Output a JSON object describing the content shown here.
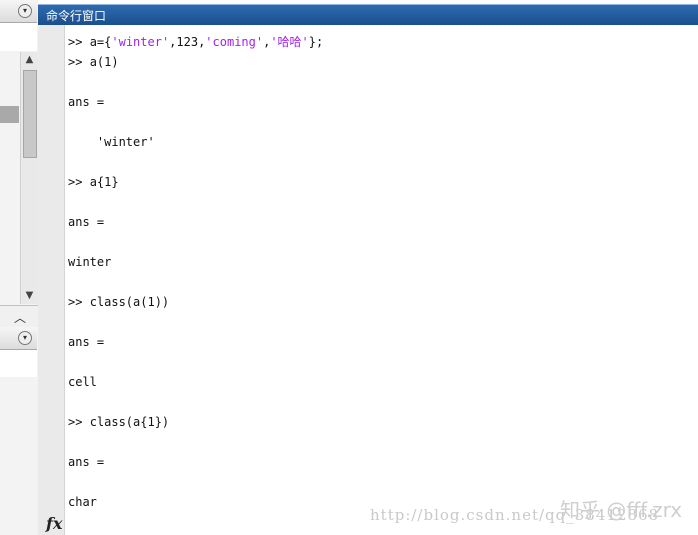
{
  "command_window": {
    "title": "命令行窗口",
    "lines": [
      {
        "prompt": ">> ",
        "parts": [
          {
            "t": "a={"
          },
          {
            "t": "'winter'",
            "s": true
          },
          {
            "t": ",123,"
          },
          {
            "t": "'coming'",
            "s": true
          },
          {
            "t": ","
          },
          {
            "t": "'哈哈'",
            "s": true
          },
          {
            "t": "};"
          }
        ]
      },
      {
        "prompt": ">> ",
        "parts": [
          {
            "t": "a(1)"
          }
        ]
      },
      {
        "parts": []
      },
      {
        "parts": [
          {
            "t": "ans ="
          }
        ]
      },
      {
        "parts": []
      },
      {
        "parts": [
          {
            "t": "    'winter'"
          }
        ]
      },
      {
        "parts": []
      },
      {
        "prompt": ">> ",
        "parts": [
          {
            "t": "a{1}"
          }
        ]
      },
      {
        "parts": []
      },
      {
        "parts": [
          {
            "t": "ans ="
          }
        ]
      },
      {
        "parts": []
      },
      {
        "parts": [
          {
            "t": "winter"
          }
        ]
      },
      {
        "parts": []
      },
      {
        "prompt": ">> ",
        "parts": [
          {
            "t": "class(a(1))"
          }
        ]
      },
      {
        "parts": []
      },
      {
        "parts": [
          {
            "t": "ans ="
          }
        ]
      },
      {
        "parts": []
      },
      {
        "parts": [
          {
            "t": "cell"
          }
        ]
      },
      {
        "parts": []
      },
      {
        "prompt": ">> ",
        "parts": [
          {
            "t": "class(a{1})"
          }
        ]
      },
      {
        "parts": []
      },
      {
        "parts": [
          {
            "t": "ans ="
          }
        ]
      },
      {
        "parts": []
      },
      {
        "parts": [
          {
            "t": "char"
          }
        ]
      }
    ],
    "fx_label": "fx",
    "string_color": "#a020f0"
  },
  "watermark": {
    "url": "http://blog.csdn.net/qq_38412868",
    "brand": "知乎 @fff.zrx"
  },
  "icons": {
    "panel_menu": "dropdown-circle-icon",
    "scroll_up": "chevron-up-icon",
    "scroll_down": "chevron-down-icon"
  }
}
